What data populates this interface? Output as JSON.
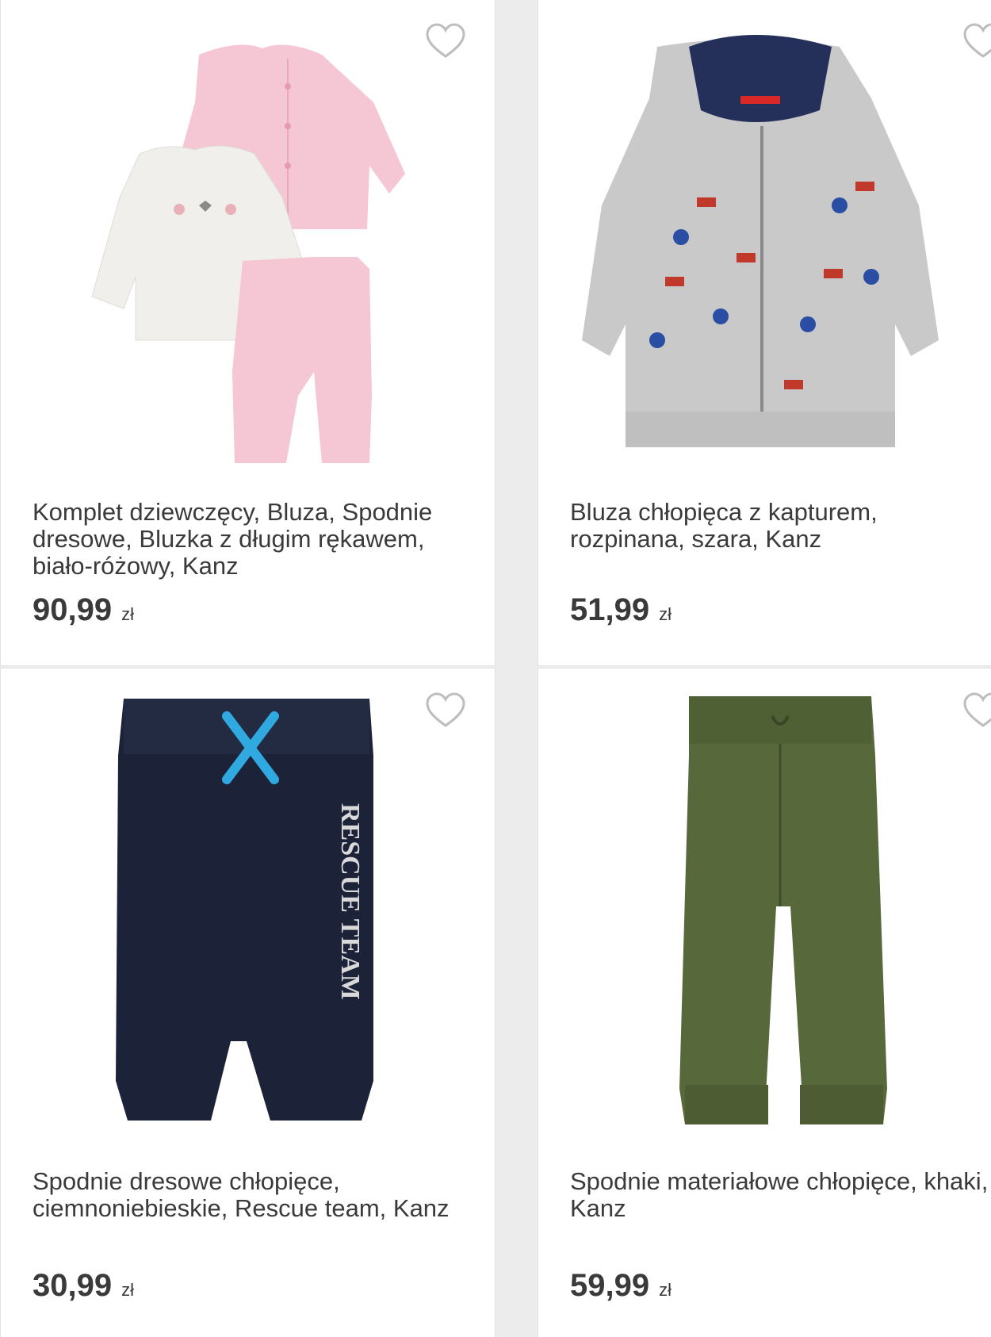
{
  "products": [
    {
      "title": "Komplet dziewczęcy, Bluza, Spodnie dresowe, Bluzka z długim rękawem, biało-różowy, Kanz",
      "price": "90,99",
      "currency": "zł",
      "image_alt": "pink-white baby set"
    },
    {
      "title": "Bluza chłopięca z kapturem, rozpinana, szara, Kanz",
      "price": "51,99",
      "currency": "zł",
      "image_alt": "grey zip hoodie"
    },
    {
      "title": "Spodnie dresowe chłopięce, ciemnoniebieskie, Rescue team, Kanz",
      "price": "30,99",
      "currency": "zł",
      "print_text": "RESCUE TEAM",
      "image_alt": "navy sweatpants"
    },
    {
      "title": "Spodnie materiałowe chłopięce, khaki, Kanz",
      "price": "59,99",
      "currency": "zł",
      "image_alt": "khaki trousers"
    }
  ]
}
